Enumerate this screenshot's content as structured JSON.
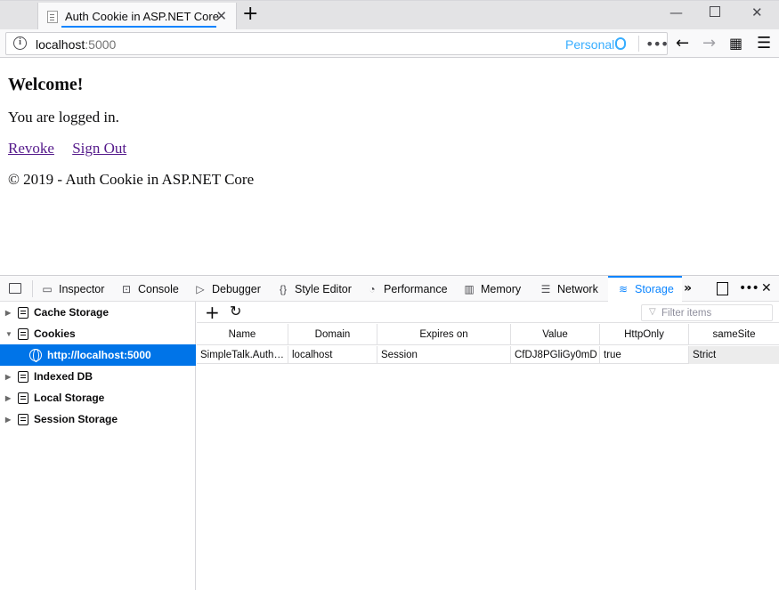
{
  "browser": {
    "tab_title": "Auth Cookie in ASP.NET Core",
    "url_host": "localhost",
    "url_port": ":5000",
    "container_label": "Personal"
  },
  "page": {
    "heading": "Welcome!",
    "message": "You are logged in.",
    "links": [
      "Revoke",
      "Sign Out"
    ],
    "footer": "© 2019 - Auth Cookie in ASP.NET Core"
  },
  "devtools": {
    "tabs": [
      "Inspector",
      "Console",
      "Debugger",
      "Style Editor",
      "Performance",
      "Memory",
      "Network",
      "Storage"
    ],
    "active_tab": "Storage",
    "sidebar": {
      "items": [
        "Cache Storage",
        "Cookies",
        "Indexed DB",
        "Local Storage",
        "Session Storage"
      ],
      "selected_child": "http://localhost:5000"
    },
    "filter_placeholder": "Filter items",
    "table": {
      "columns": [
        "Name",
        "Domain",
        "Expires on",
        "Value",
        "HttpOnly",
        "sameSite"
      ],
      "rows": [
        [
          "SimpleTalk.AuthCookie",
          "localhost",
          "Session",
          "CfDJ8PGliGy0mD",
          "true",
          "Strict"
        ]
      ]
    }
  },
  "colors": {
    "accent": "#0a84ff",
    "selected_bg": "#0074e8",
    "visited_link": "#551a8b"
  }
}
